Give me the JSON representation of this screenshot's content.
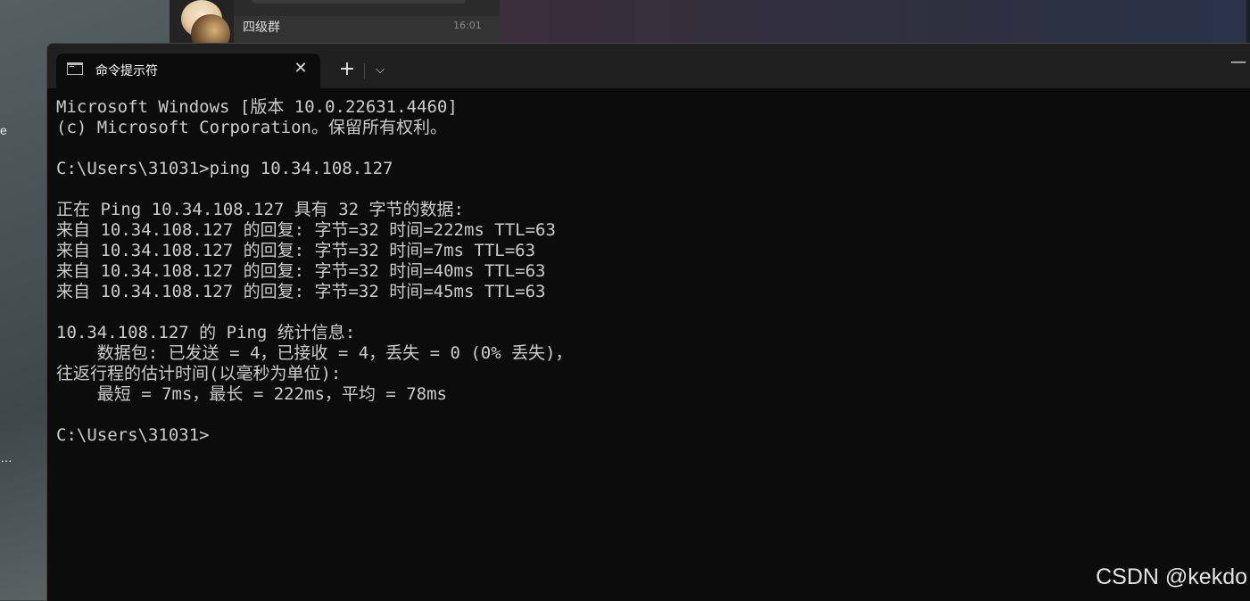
{
  "desktop": {
    "left_fragment_1": "e",
    "left_fragment_2": "…",
    "watermark": "CSDN @kekdo"
  },
  "background_app": {
    "chat_name": "四级群",
    "chat_time": "16:01"
  },
  "terminal": {
    "tab_title": "命令提示符",
    "close_glyph": "✕",
    "new_tab_glyph": "+",
    "dropdown_glyph": "⌵",
    "minimize_glyph": "—",
    "lines": [
      "Microsoft Windows [版本 10.0.22631.4460]",
      "(c) Microsoft Corporation。保留所有权利。",
      "",
      "C:\\Users\\31031>ping 10.34.108.127",
      "",
      "正在 Ping 10.34.108.127 具有 32 字节的数据:",
      "来自 10.34.108.127 的回复: 字节=32 时间=222ms TTL=63",
      "来自 10.34.108.127 的回复: 字节=32 时间=7ms TTL=63",
      "来自 10.34.108.127 的回复: 字节=32 时间=40ms TTL=63",
      "来自 10.34.108.127 的回复: 字节=32 时间=45ms TTL=63",
      "",
      "10.34.108.127 的 Ping 统计信息:",
      "    数据包: 已发送 = 4，已接收 = 4，丢失 = 0 (0% 丢失)，",
      "往返行程的估计时间(以毫秒为单位):",
      "    最短 = 7ms，最长 = 222ms，平均 = 78ms",
      "",
      "C:\\Users\\31031>"
    ]
  },
  "icons": {
    "tab_icon": "command-prompt-icon",
    "close": "close-icon",
    "new_tab": "plus-icon",
    "dropdown": "chevron-down-icon",
    "minimize": "minimize-icon"
  },
  "colors": {
    "console_bg": "#0c0c0c",
    "console_text": "#cccccc",
    "titlebar_bg": "#202020"
  }
}
